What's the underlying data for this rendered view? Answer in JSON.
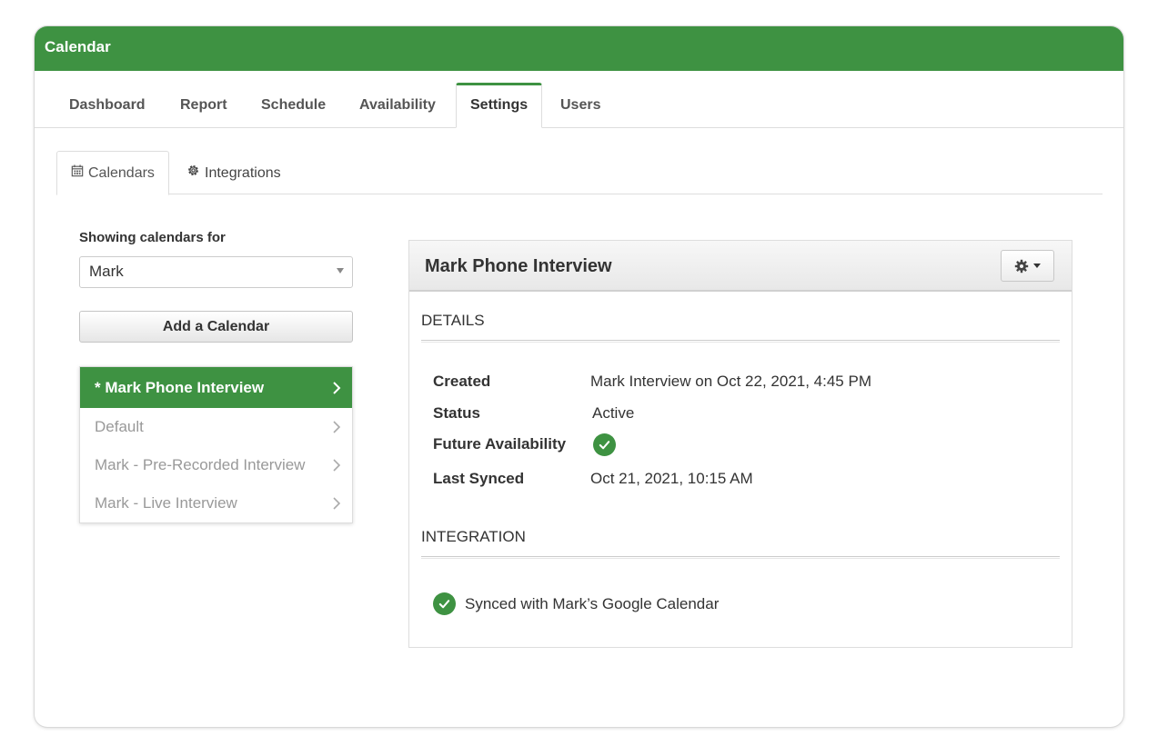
{
  "app": {
    "title": "Calendar"
  },
  "main_tabs": [
    {
      "label": "Dashboard"
    },
    {
      "label": "Report"
    },
    {
      "label": "Schedule"
    },
    {
      "label": "Availability"
    },
    {
      "label": "Settings",
      "active": true
    },
    {
      "label": "Users"
    }
  ],
  "sub_tabs": [
    {
      "label": "Calendars",
      "icon": "calendar-icon",
      "active": true
    },
    {
      "label": "Integrations",
      "icon": "gear-icon"
    }
  ],
  "sidebar": {
    "showing_label": "Showing calendars for",
    "selected_user": "Mark",
    "add_button_label": "Add a Calendar",
    "calendars": [
      {
        "label": "* Mark Phone Interview",
        "active": true
      },
      {
        "label": "Default"
      },
      {
        "label": "Mark - Pre-Recorded Interview"
      },
      {
        "label": "Mark - Live Interview"
      }
    ]
  },
  "detail": {
    "title": "Mark Phone Interview",
    "details_heading": "DETAILS",
    "fields": {
      "created_label": "Created",
      "created_value": "Mark Interview on Oct 22, 2021, 4:45 PM",
      "status_label": "Status",
      "status_value": "Active",
      "future_label": "Future Availability",
      "future_value": true,
      "synced_label": "Last Synced",
      "synced_value": "Oct 21, 2021, 10:15 AM"
    },
    "integration_heading": "INTEGRATION",
    "integration_text": "Synced with Mark’s Google Calendar"
  },
  "colors": {
    "brand_green": "#3e9242",
    "border": "#dddddd",
    "muted_text": "#999999"
  }
}
